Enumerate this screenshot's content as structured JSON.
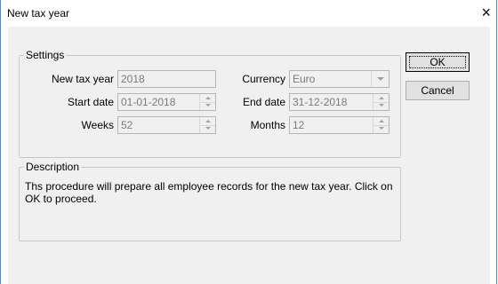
{
  "window": {
    "title": "New tax year",
    "close_glyph": "×"
  },
  "settings": {
    "legend": "Settings",
    "new_tax_year": {
      "label": "New tax year",
      "value": "2018"
    },
    "currency": {
      "label": "Currency",
      "value": "Euro"
    },
    "start_date": {
      "label": "Start date",
      "value": "01-01-2018"
    },
    "end_date": {
      "label": "End date",
      "value": "31-12-2018"
    },
    "weeks": {
      "label": "Weeks",
      "value": "52"
    },
    "months": {
      "label": "Months",
      "value": "12"
    }
  },
  "description": {
    "legend": "Description",
    "text": "Ths procedure will prepare all employee records for the new tax year. Click on OK to proceed."
  },
  "buttons": {
    "ok": "OK",
    "cancel": "Cancel"
  },
  "icons": {
    "spin_up": "arrow-up-icon",
    "spin_down": "arrow-down-icon",
    "dropdown": "chevron-down-icon",
    "close": "close-icon"
  }
}
